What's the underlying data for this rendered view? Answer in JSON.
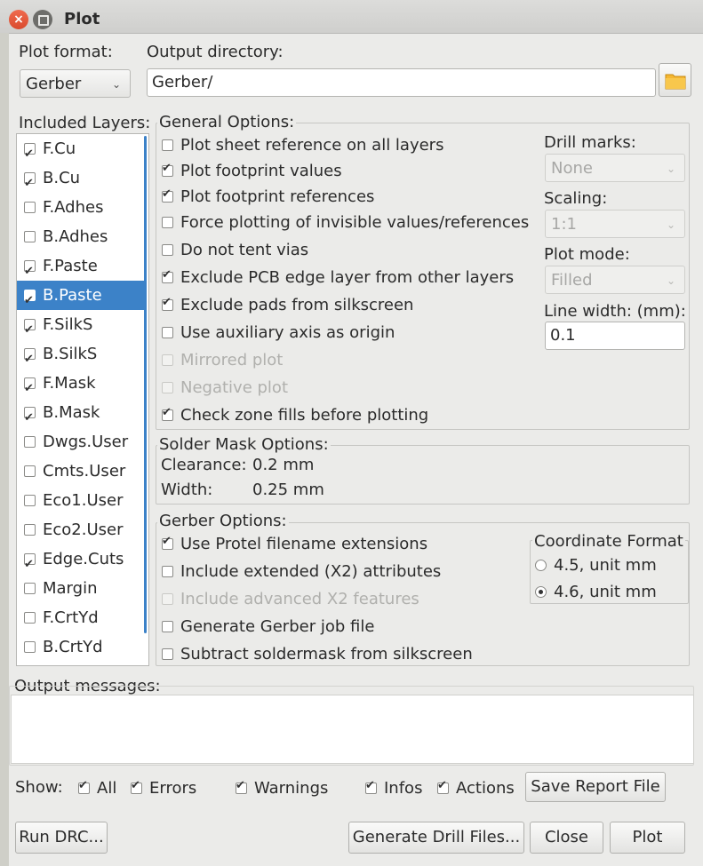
{
  "window": {
    "title": "Plot",
    "close_glyph": "×"
  },
  "plot_format": {
    "label": "Plot format:",
    "value": "Gerber"
  },
  "output_directory": {
    "label": "Output directory:",
    "value": "Gerber/"
  },
  "layers": {
    "label": "Included Layers:",
    "items": [
      {
        "label": "F.Cu",
        "checked": true
      },
      {
        "label": "B.Cu",
        "checked": true
      },
      {
        "label": "F.Adhes",
        "checked": false
      },
      {
        "label": "B.Adhes",
        "checked": false
      },
      {
        "label": "F.Paste",
        "checked": true
      },
      {
        "label": "B.Paste",
        "checked": true,
        "selected": true
      },
      {
        "label": "F.SilkS",
        "checked": true
      },
      {
        "label": "B.SilkS",
        "checked": true
      },
      {
        "label": "F.Mask",
        "checked": true
      },
      {
        "label": "B.Mask",
        "checked": true
      },
      {
        "label": "Dwgs.User",
        "checked": false
      },
      {
        "label": "Cmts.User",
        "checked": false
      },
      {
        "label": "Eco1.User",
        "checked": false
      },
      {
        "label": "Eco2.User",
        "checked": false
      },
      {
        "label": "Edge.Cuts",
        "checked": true
      },
      {
        "label": "Margin",
        "checked": false
      },
      {
        "label": "F.CrtYd",
        "checked": false
      },
      {
        "label": "B.CrtYd",
        "checked": false
      }
    ]
  },
  "general_options": {
    "title": "General Options:",
    "items": [
      {
        "label": "Plot sheet reference on all layers",
        "checked": false,
        "enabled": true
      },
      {
        "label": "Plot footprint values",
        "checked": true,
        "enabled": true
      },
      {
        "label": "Plot footprint references",
        "checked": true,
        "enabled": true
      },
      {
        "label": "Force plotting of invisible values/references",
        "checked": false,
        "enabled": true
      },
      {
        "label": "Do not tent vias",
        "checked": false,
        "enabled": true
      },
      {
        "label": "Exclude PCB edge layer from other layers",
        "checked": true,
        "enabled": true
      },
      {
        "label": "Exclude pads from silkscreen",
        "checked": true,
        "enabled": true
      },
      {
        "label": "Use auxiliary axis as origin",
        "checked": false,
        "enabled": true
      },
      {
        "label": "Mirrored plot",
        "checked": false,
        "enabled": false
      },
      {
        "label": "Negative plot",
        "checked": false,
        "enabled": false
      },
      {
        "label": "Check zone fills before plotting",
        "checked": true,
        "enabled": true
      }
    ],
    "drill_marks": {
      "label": "Drill marks:",
      "value": "None"
    },
    "scaling": {
      "label": "Scaling:",
      "value": "1:1"
    },
    "plot_mode": {
      "label": "Plot mode:",
      "value": "Filled"
    },
    "line_width": {
      "label": "Line width: (mm):",
      "value": "0.1"
    }
  },
  "solder_mask": {
    "title": "Solder Mask Options:",
    "clearance_label": "Clearance:",
    "clearance_value": "0.2 mm",
    "width_label": "Width:",
    "width_value": "0.25 mm"
  },
  "gerber_options": {
    "title": "Gerber Options:",
    "items": [
      {
        "label": "Use Protel filename extensions",
        "checked": true,
        "enabled": true
      },
      {
        "label": "Include extended (X2) attributes",
        "checked": false,
        "enabled": true
      },
      {
        "label": "Include advanced X2 features",
        "checked": false,
        "enabled": false
      },
      {
        "label": "Generate Gerber job file",
        "checked": false,
        "enabled": true
      },
      {
        "label": "Subtract soldermask from silkscreen",
        "checked": false,
        "enabled": true
      }
    ],
    "coordinate_format": {
      "title": "Coordinate Format",
      "options": [
        {
          "label": "4.5, unit mm",
          "selected": false
        },
        {
          "label": "4.6, unit mm",
          "selected": true
        }
      ]
    }
  },
  "output_messages": {
    "label": "Output messages:"
  },
  "show_filters": {
    "label": "Show:",
    "items": [
      {
        "label": "All",
        "checked": true
      },
      {
        "label": "Errors",
        "checked": true
      },
      {
        "label": "Warnings",
        "checked": true
      },
      {
        "label": "Infos",
        "checked": true
      },
      {
        "label": "Actions",
        "checked": true
      }
    ],
    "save_report_label": "Save Report File"
  },
  "buttons": {
    "run_drc": "Run DRC...",
    "generate_drill": "Generate Drill Files...",
    "close": "Close",
    "plot": "Plot"
  },
  "icons": {
    "combo_arrow": "⌄"
  }
}
